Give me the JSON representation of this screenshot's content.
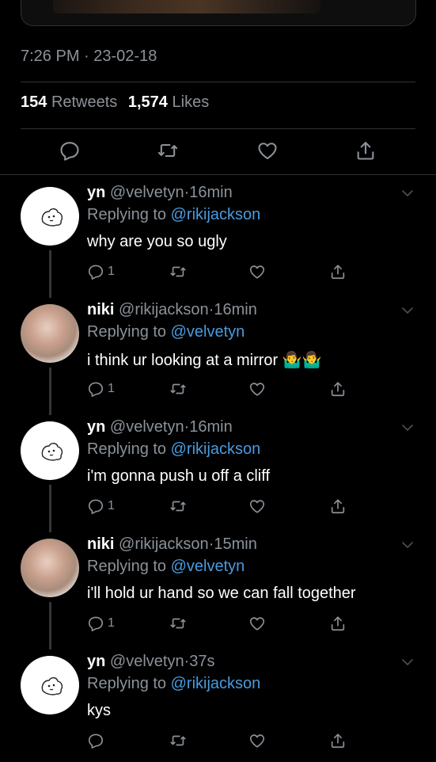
{
  "tweet": {
    "timestamp": "7:26 PM · 23-02-18",
    "retweets_count": "154",
    "retweets_label": "Retweets",
    "likes_count": "1,574",
    "likes_label": "Likes"
  },
  "icons": {
    "reply": "reply-icon",
    "retweet": "retweet-icon",
    "like": "heart-icon",
    "share": "share-icon",
    "more": "chevron-down-icon"
  },
  "colors": {
    "background": "#000000",
    "text": "#ffffff",
    "muted": "#8b9299",
    "link": "#4a9be0",
    "divider": "#2f3336"
  },
  "replies": [
    {
      "name": "yn",
      "handle": "@velvetyn",
      "separator": "·",
      "time": "16min",
      "replying_prefix": "Replying to",
      "replying_to": "@rikijackson",
      "text": "why are you so ugly",
      "reply_count": "1",
      "avatar": "yn"
    },
    {
      "name": "niki",
      "handle": "@rikijackson",
      "separator": "·",
      "time": "16min",
      "replying_prefix": "Replying to",
      "replying_to": "@velvetyn",
      "text": "i think ur looking at a mirror",
      "reply_count": "1",
      "avatar": "niki",
      "emoji": "🤷‍♂️🤷‍♂️"
    },
    {
      "name": "yn",
      "handle": "@velvetyn",
      "separator": "·",
      "time": "16min",
      "replying_prefix": "Replying to",
      "replying_to": "@rikijackson",
      "text": "i'm gonna push u off a cliff",
      "reply_count": "1",
      "avatar": "yn"
    },
    {
      "name": "niki",
      "handle": "@rikijackson",
      "separator": "·",
      "time": "15min",
      "replying_prefix": "Replying to",
      "replying_to": "@velvetyn",
      "text": "i'll hold ur hand so we can fall together",
      "reply_count": "1",
      "avatar": "niki"
    },
    {
      "name": "yn",
      "handle": "@velvetyn",
      "separator": "·",
      "time": "37s",
      "replying_prefix": "Replying to",
      "replying_to": "@rikijackson",
      "text": "kys",
      "reply_count": "",
      "avatar": "yn"
    }
  ]
}
